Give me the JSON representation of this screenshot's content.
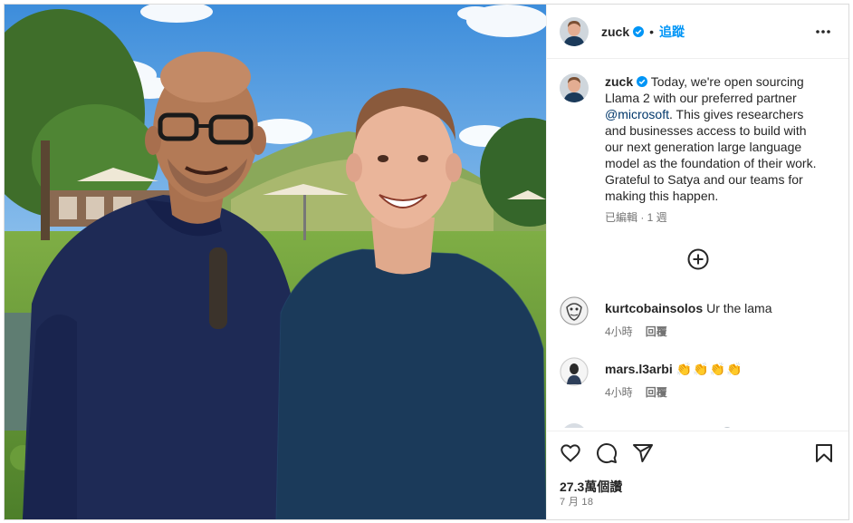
{
  "post": {
    "username": "zuck",
    "follow_label": "追蹤",
    "caption": {
      "part1": "Today, we're open sourcing Llama 2 with our preferred partner ",
      "mention": "@microsoft",
      "part2": ". This gives researchers and businesses access to build with our next generation large language model as the foundation of their work. Grateful to Satya and our teams for making this happen."
    },
    "caption_meta": "已編輯 · 1 週",
    "likes": "27.3萬個讚",
    "date": "7 月 18"
  },
  "comments": [
    {
      "username": "kurtcobainsolos",
      "text": "Ur the lama",
      "time": "4小時",
      "reply_label": "回覆"
    },
    {
      "username": "mars.l3arbi",
      "text": "👏👏👏👏",
      "time": "4小時",
      "reply_label": "回覆"
    }
  ],
  "icons": {
    "verified": "verified-badge-icon",
    "more": "more-options-icon",
    "load_more": "plus-circle-icon",
    "like": "heart-icon",
    "comment": "comment-icon",
    "share": "share-icon",
    "save": "bookmark-icon"
  },
  "colors": {
    "accent": "#0095f6",
    "verified": "#0095f6",
    "mention": "#00376b",
    "secondary_text": "#737373"
  }
}
